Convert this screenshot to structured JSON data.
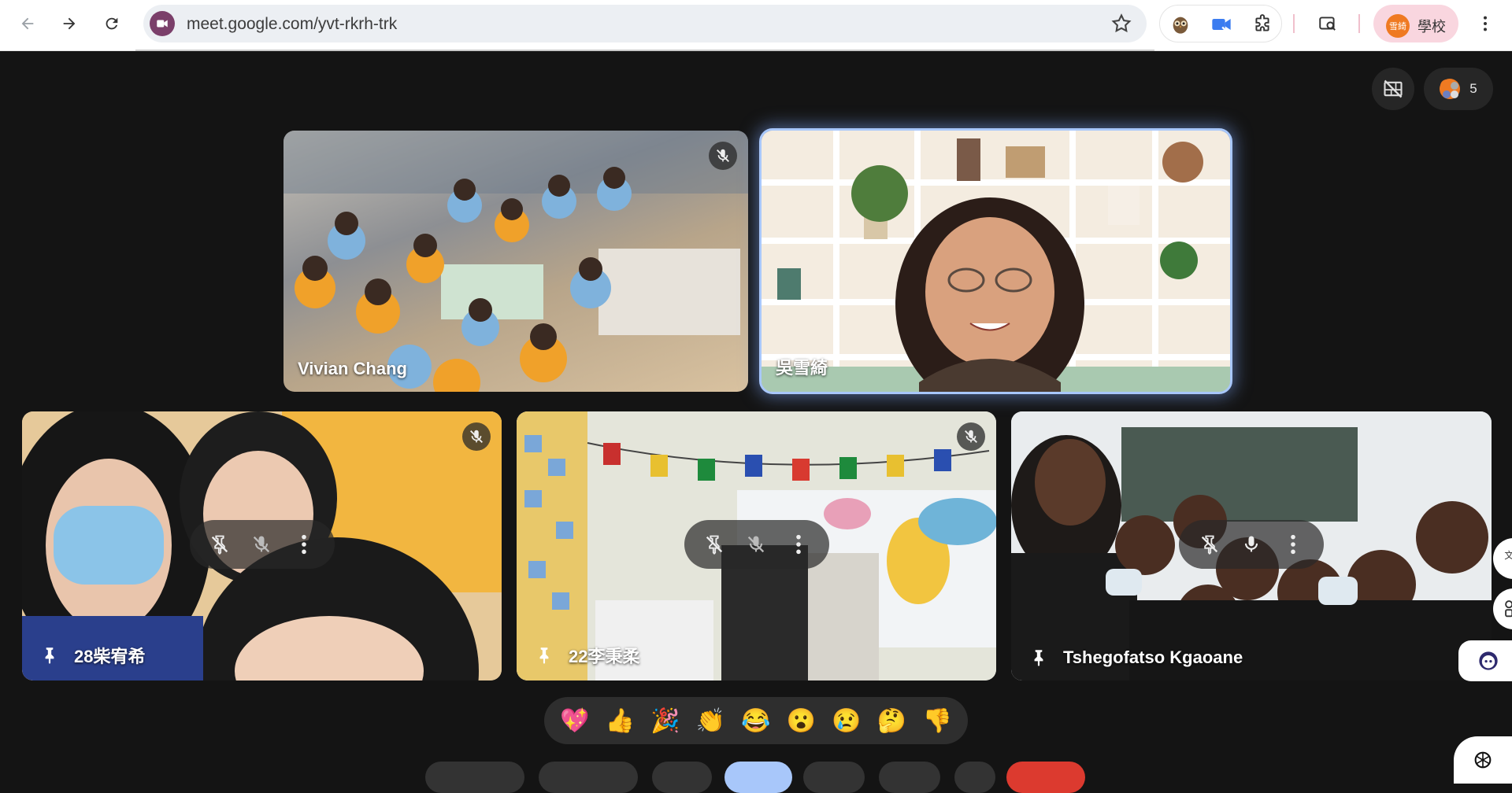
{
  "browser": {
    "url": "meet.google.com/yvt-rkrh-trk",
    "profile_avatar": "雪綺",
    "profile_name": "學校"
  },
  "meet": {
    "participant_count": "5",
    "people_avatar": "雪綺",
    "tiles": [
      {
        "name": "Vivian Chang",
        "muted": true
      },
      {
        "name": "吳雪綺",
        "muted": false,
        "selected": true
      },
      {
        "name": "28柴宥希",
        "muted": true,
        "pinned": true
      },
      {
        "name": "22李秉柔",
        "muted": true,
        "pinned": true
      },
      {
        "name": "Tshegofatso Kgaoane",
        "muted": false,
        "pinned": true
      }
    ],
    "reactions": [
      "💖",
      "👍",
      "🎉",
      "👏",
      "😂",
      "😮",
      "😢",
      "🤔",
      "👎"
    ]
  },
  "colors": {
    "meet_bg": "#141414",
    "selected_outline": "#a8c7fa",
    "end_call": "#dc3a2f",
    "active_control": "#a8c7fa",
    "profile_pill": "#f9d6df"
  }
}
